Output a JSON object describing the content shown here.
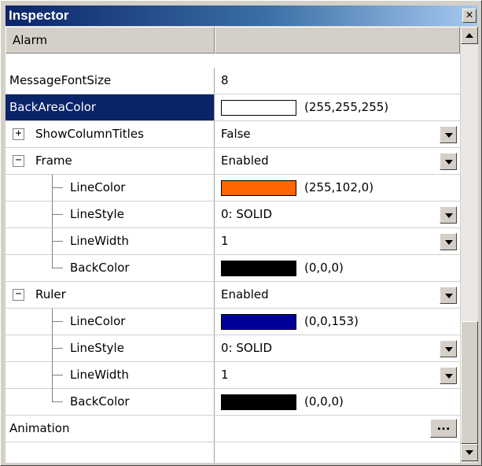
{
  "window": {
    "title": "Inspector",
    "close_glyph": "✕"
  },
  "header": {
    "name": "Alarm",
    "value": ""
  },
  "rows": [
    {
      "name": "MessageFontSize",
      "value": "8"
    },
    {
      "name": "BackAreaColor",
      "swatch": "#ffffff",
      "value": "(255,255,255)",
      "selected": true
    },
    {
      "name": "ShowColumnTitles",
      "value": "False",
      "expander": "+"
    },
    {
      "name": "Frame",
      "value": "Enabled",
      "expander": "−"
    },
    {
      "name": "LineColor",
      "swatch": "#ff6600",
      "value": "(255,102,0)"
    },
    {
      "name": "LineStyle",
      "value": "0: SOLID"
    },
    {
      "name": "LineWidth",
      "value": "1"
    },
    {
      "name": "BackColor",
      "swatch": "#000000",
      "value": "(0,0,0)"
    },
    {
      "name": "Ruler",
      "value": "Enabled",
      "expander": "−"
    },
    {
      "name": "LineColor",
      "swatch": "#000099",
      "value": "(0,0,153)"
    },
    {
      "name": "LineStyle",
      "value": "0: SOLID"
    },
    {
      "name": "LineWidth",
      "value": "1"
    },
    {
      "name": "BackColor",
      "swatch": "#000000",
      "value": "(0,0,0)"
    },
    {
      "name": "Animation",
      "value": "",
      "button": "..."
    }
  ],
  "colors": {
    "selection": "#0a246a",
    "chrome": "#d4d0c8"
  },
  "icons": {
    "dropdown": "chevron-down-icon",
    "scroll_up": "arrow-up-icon",
    "scroll_down": "arrow-down-icon"
  }
}
